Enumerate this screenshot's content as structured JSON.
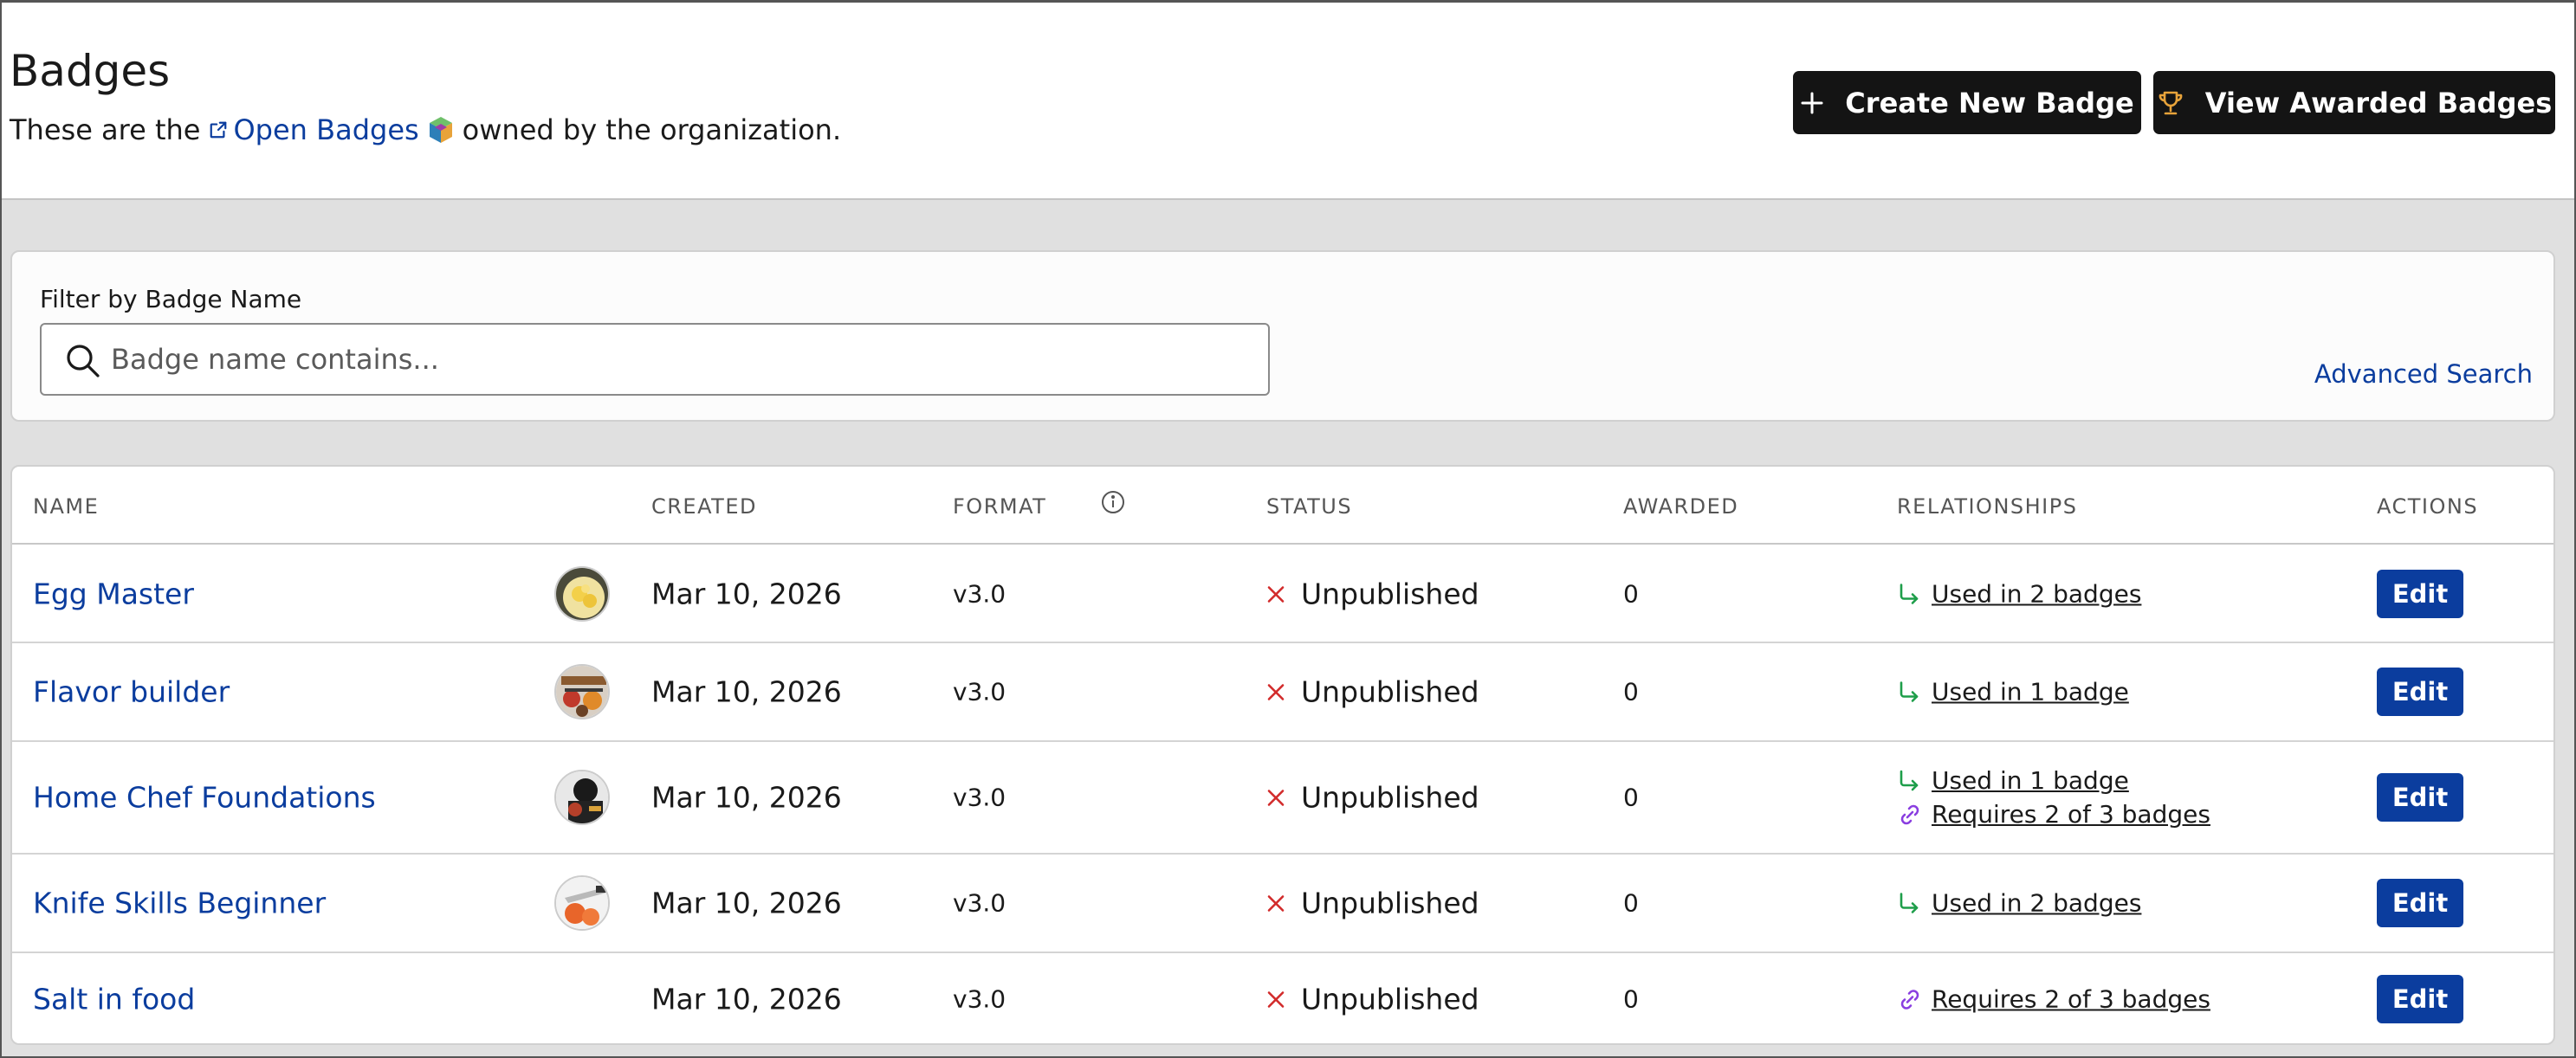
{
  "header": {
    "title": "Badges",
    "subtitle_prefix": "These are the",
    "subtitle_link": "Open Badges",
    "subtitle_suffix": "owned by the organization.",
    "create_button": "Create New Badge",
    "view_button": "View Awarded Badges"
  },
  "filter": {
    "label": "Filter by Badge Name",
    "placeholder": "Badge name contains...",
    "value": "",
    "advanced_search": "Advanced Search"
  },
  "table": {
    "columns": {
      "name": "NAME",
      "created": "CREATED",
      "format": "FORMAT",
      "status": "STATUS",
      "awarded": "AWARDED",
      "relationships": "RELATIONSHIPS",
      "actions": "ACTIONS"
    },
    "rows": [
      {
        "name": "Egg Master",
        "thumbnail": "egg-dish-image",
        "created": "Mar 10, 2026",
        "format": "v3.0",
        "status": "Unpublished",
        "awarded": "0",
        "relationships": [
          {
            "type": "used-in",
            "label": "Used in 2 badges"
          }
        ],
        "action": "Edit"
      },
      {
        "name": "Flavor builder",
        "thumbnail": "spices-image",
        "created": "Mar 10, 2026",
        "format": "v3.0",
        "status": "Unpublished",
        "awarded": "0",
        "relationships": [
          {
            "type": "used-in",
            "label": "Used in 1 badge"
          }
        ],
        "action": "Edit"
      },
      {
        "name": "Home Chef Foundations",
        "thumbnail": "chef-image",
        "created": "Mar 10, 2026",
        "format": "v3.0",
        "status": "Unpublished",
        "awarded": "0",
        "relationships": [
          {
            "type": "used-in",
            "label": "Used in 1 badge"
          },
          {
            "type": "requires",
            "label": "Requires 2 of 3 badges"
          }
        ],
        "action": "Edit"
      },
      {
        "name": "Knife Skills Beginner",
        "thumbnail": "knife-carrots-image",
        "created": "Mar 10, 2026",
        "format": "v3.0",
        "status": "Unpublished",
        "awarded": "0",
        "relationships": [
          {
            "type": "used-in",
            "label": "Used in 2 badges"
          }
        ],
        "action": "Edit"
      },
      {
        "name": "Salt in food",
        "thumbnail": "",
        "created": "Mar 10, 2026",
        "format": "v3.0",
        "status": "Unpublished",
        "awarded": "0",
        "relationships": [
          {
            "type": "requires",
            "label": "Requires 2 of 3 badges"
          }
        ],
        "action": "Edit"
      }
    ]
  },
  "colors": {
    "link": "#0b3d9e",
    "primary_button": "#0b3d9e",
    "dark_button": "#141414",
    "status_x": "#d22b2b",
    "used_in_arrow": "#1e9e4a",
    "requires_link": "#8a3ee0",
    "trophy": "#e8a33a"
  }
}
